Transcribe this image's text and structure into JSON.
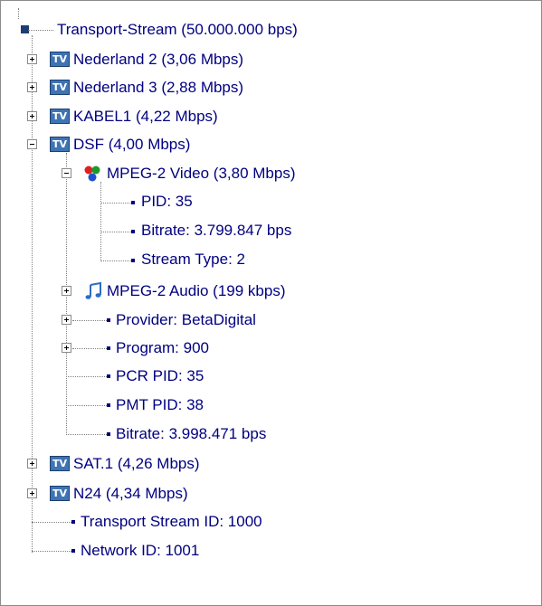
{
  "tree": {
    "root": {
      "label": "Transport-Stream  (50.000.000 bps)",
      "icon": "root-node-icon"
    },
    "services_top": [
      {
        "label": "Nederland 2 (3,06 Mbps)",
        "icon": "tv-icon",
        "expanded": false
      },
      {
        "label": "Nederland 3 (2,88 Mbps)",
        "icon": "tv-icon",
        "expanded": false
      },
      {
        "label": "KABEL1 (4,22 Mbps)",
        "icon": "tv-icon",
        "expanded": false
      },
      {
        "label": "DSF (4,00 Mbps)",
        "icon": "tv-icon",
        "expanded": true
      }
    ],
    "tv_badge": "TV",
    "dsf": {
      "video": {
        "label": "MPEG-2 Video (3,80 Mbps)",
        "icon": "video-rgb-icon",
        "expanded": true
      },
      "video_props": [
        "PID: 35",
        "Bitrate: 3.799.847 bps",
        "Stream Type: 2"
      ],
      "audio": {
        "label": "MPEG-2 Audio (199 kbps)",
        "icon": "music-note-icon",
        "expanded": false
      },
      "provider": "Provider: BetaDigital",
      "program": "Program: 900",
      "pcr_pid": "PCR PID: 35",
      "pmt_pid": "PMT PID: 38",
      "bitrate": "Bitrate: 3.998.471 bps"
    },
    "services_bottom": [
      {
        "label": "SAT.1 (4,26 Mbps)",
        "icon": "tv-icon",
        "expanded": false
      },
      {
        "label": "N24 (4,34 Mbps)",
        "icon": "tv-icon",
        "expanded": false
      }
    ],
    "ts_id": "Transport Stream ID: 1000",
    "network_id": "Network ID: 1001"
  },
  "colors": {
    "text": "#000080",
    "tv_badge": "#3d74b4",
    "lines": "#808080"
  }
}
